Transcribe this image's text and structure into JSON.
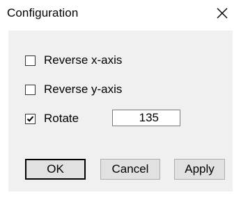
{
  "window": {
    "title": "Configuration",
    "close_icon": "close-icon"
  },
  "options": [
    {
      "label": "Reverse x-axis",
      "checked": false
    },
    {
      "label": "Reverse y-axis",
      "checked": false
    },
    {
      "label": "Rotate",
      "checked": true
    }
  ],
  "rotate": {
    "value": "135"
  },
  "buttons": {
    "ok": "OK",
    "cancel": "Cancel",
    "apply": "Apply"
  },
  "colors": {
    "dialog_background": "#ffffff",
    "client_background": "#f0f0f0",
    "button_background": "#e1e1e1"
  }
}
